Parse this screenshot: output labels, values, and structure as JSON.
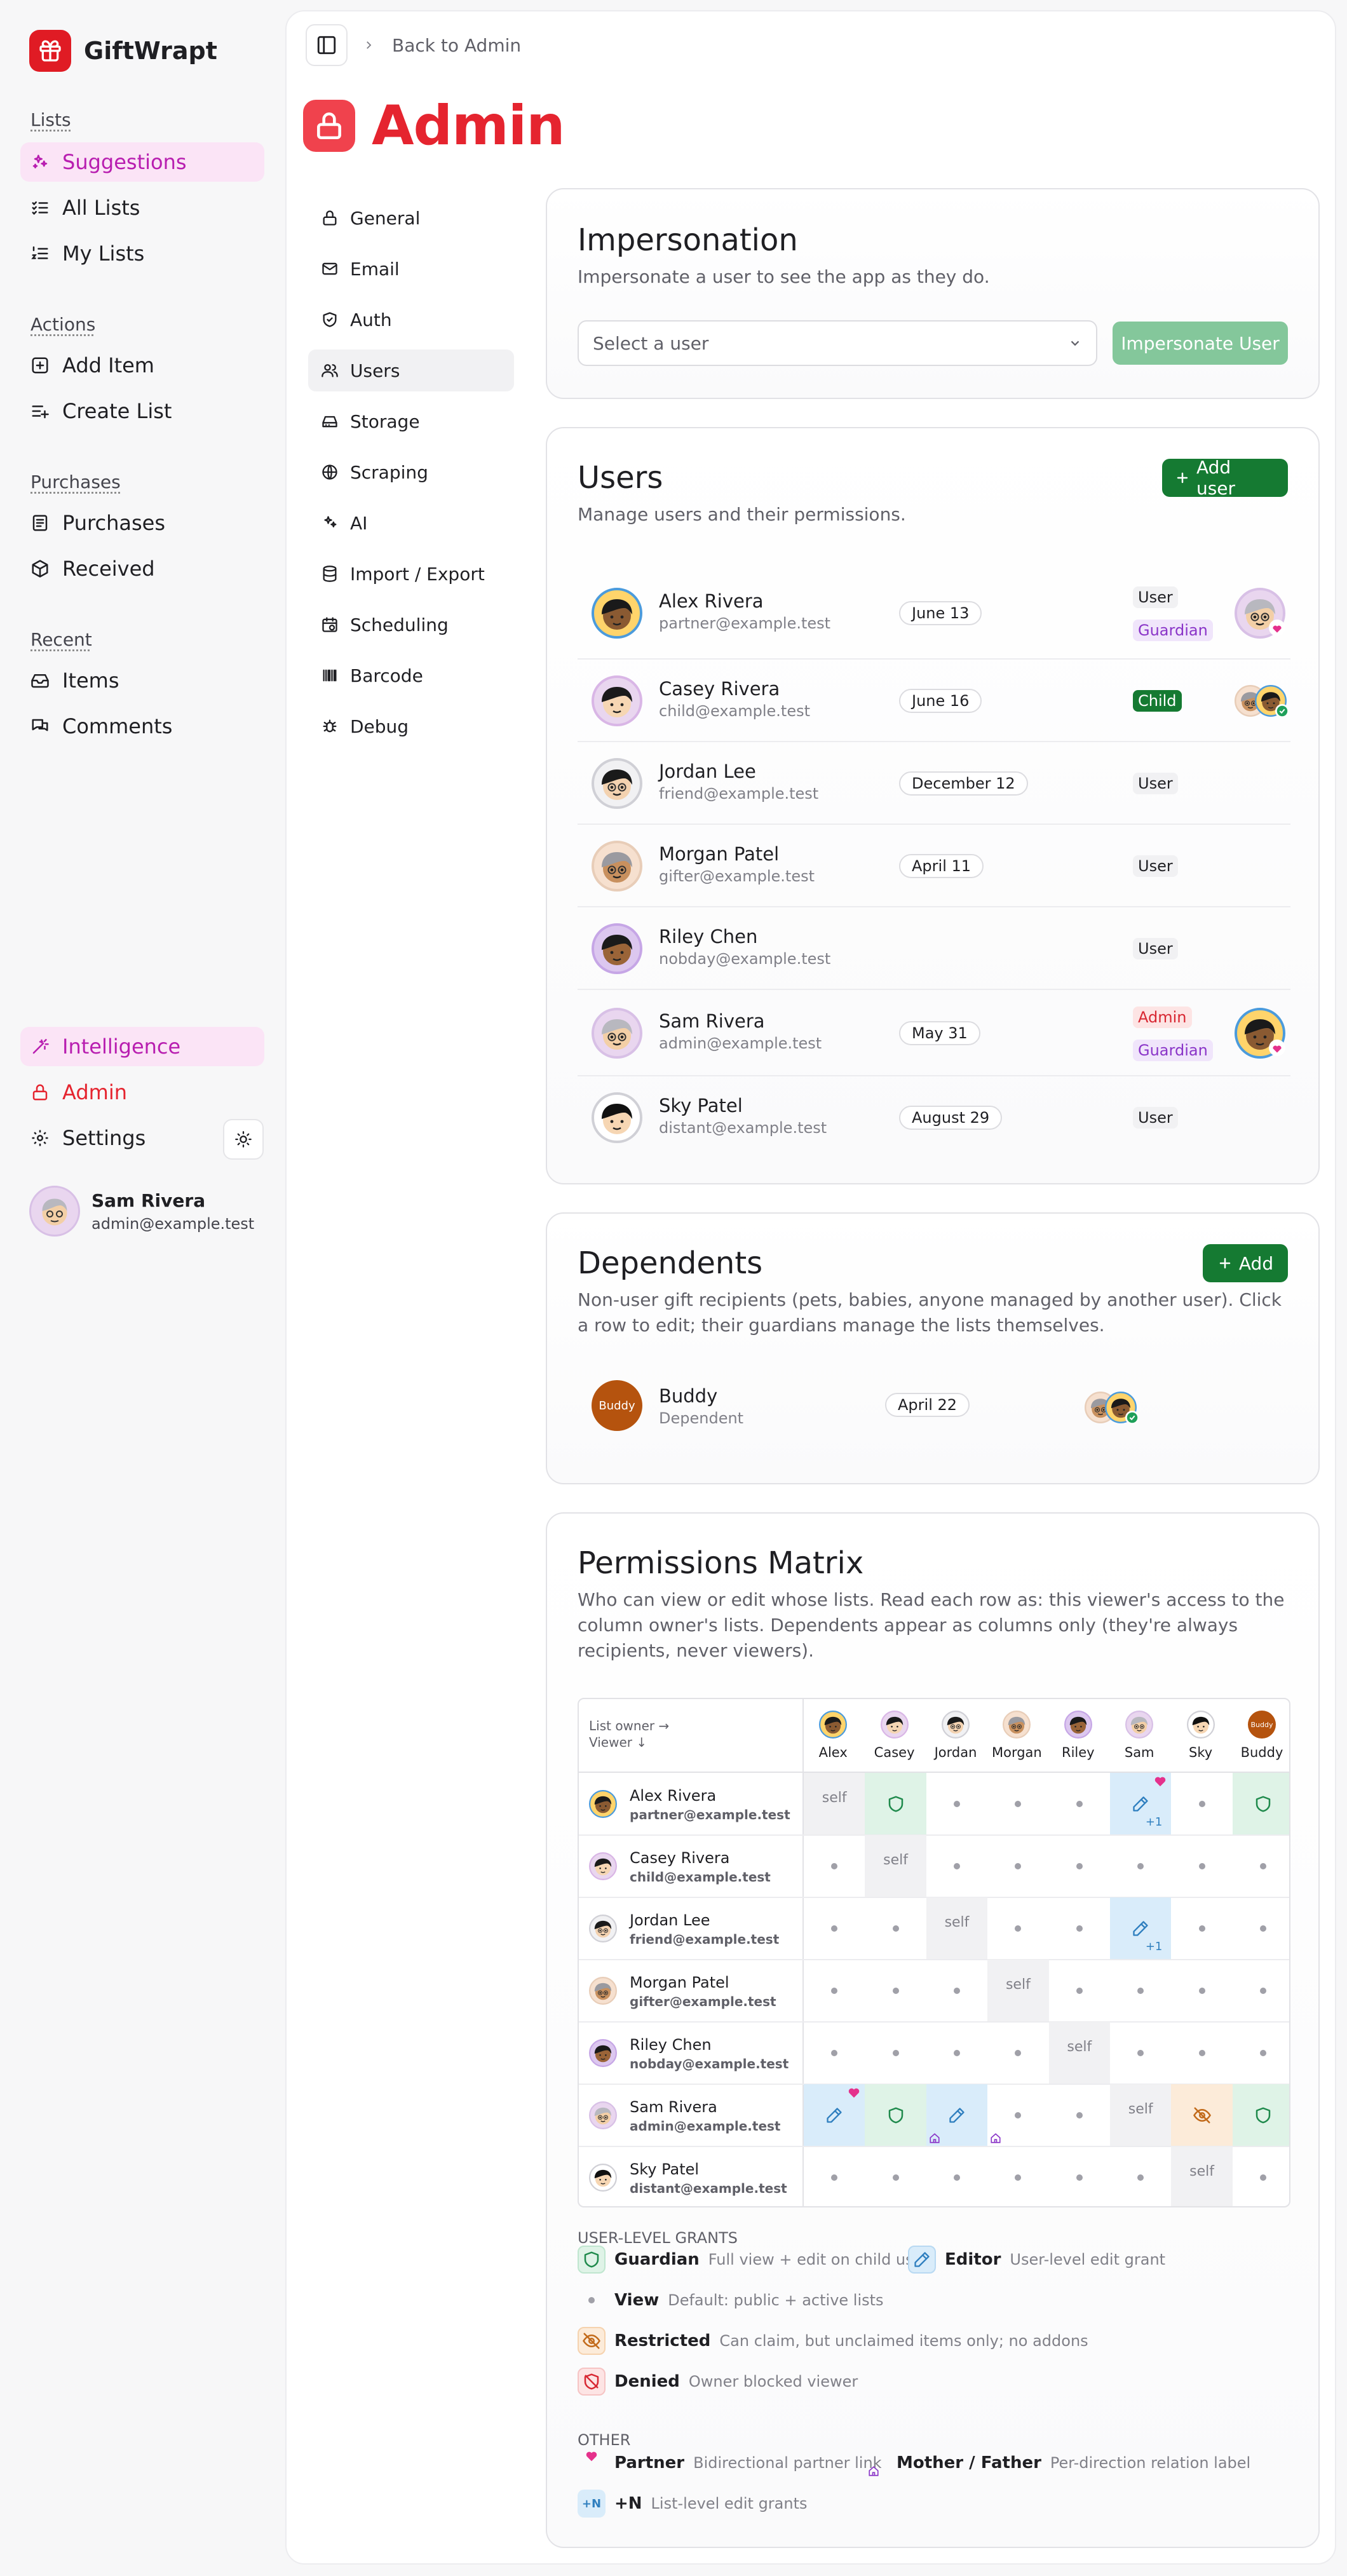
{
  "brand": {
    "name": "GiftWrapt"
  },
  "sidebar": {
    "sections": [
      {
        "head": "Lists",
        "items": [
          {
            "label": "Suggestions",
            "icon": "sparkles-icon"
          },
          {
            "label": "All Lists",
            "icon": "list-check-icon"
          },
          {
            "label": "My Lists",
            "icon": "list-ordered-icon"
          }
        ]
      },
      {
        "head": "Actions",
        "items": [
          {
            "label": "Add Item",
            "icon": "plus-square-icon"
          },
          {
            "label": "Create List",
            "icon": "list-plus-icon"
          }
        ]
      },
      {
        "head": "Purchases",
        "items": [
          {
            "label": "Purchases",
            "icon": "receipt-icon"
          },
          {
            "label": "Received",
            "icon": "package-icon"
          }
        ]
      },
      {
        "head": "Recent",
        "items": [
          {
            "label": "Items",
            "icon": "inbox-icon"
          },
          {
            "label": "Comments",
            "icon": "comments-icon"
          }
        ]
      }
    ],
    "bottom": [
      {
        "label": "Intelligence",
        "icon": "wand-icon"
      },
      {
        "label": "Admin",
        "icon": "lock-icon"
      },
      {
        "label": "Settings",
        "icon": "gear-icon"
      }
    ],
    "user": {
      "name": "Sam Rivera",
      "email": "admin@example.test"
    }
  },
  "header": {
    "crumb": "Back to Admin",
    "title": "Admin"
  },
  "subnav": [
    "General",
    "Email",
    "Auth",
    "Users",
    "Storage",
    "Scraping",
    "AI",
    "Import / Export",
    "Scheduling",
    "Barcode",
    "Debug"
  ],
  "impersonation": {
    "title": "Impersonation",
    "desc": "Impersonate a user to see the app as they do.",
    "placeholder": "Select a user",
    "button": "Impersonate User"
  },
  "users": {
    "title": "Users",
    "desc": "Manage users and their permissions.",
    "add": "Add user",
    "rows": [
      {
        "name": "Alex Rivera",
        "email": "partner@example.test",
        "date": "June 13",
        "tags": [
          "User",
          "Guardian"
        ]
      },
      {
        "name": "Casey Rivera",
        "email": "child@example.test",
        "date": "June 16",
        "tags": [
          "Child"
        ]
      },
      {
        "name": "Jordan Lee",
        "email": "friend@example.test",
        "date": "December 12",
        "tags": [
          "User"
        ]
      },
      {
        "name": "Morgan Patel",
        "email": "gifter@example.test",
        "date": "April 11",
        "tags": [
          "User"
        ]
      },
      {
        "name": "Riley Chen",
        "email": "nobday@example.test",
        "date": "",
        "tags": [
          "User"
        ]
      },
      {
        "name": "Sam Rivera",
        "email": "admin@example.test",
        "date": "May 31",
        "tags": [
          "Admin",
          "Guardian"
        ]
      },
      {
        "name": "Sky Patel",
        "email": "distant@example.test",
        "date": "August 29",
        "tags": [
          "User"
        ]
      }
    ]
  },
  "dependents": {
    "title": "Dependents",
    "desc": "Non-user gift recipients (pets, babies, anyone managed by another user). Click a row to edit; their guardians manage the lists themselves.",
    "add": "Add",
    "rows": [
      {
        "name": "Buddy",
        "sub": "Dependent",
        "date": "April 22",
        "avatar": "Buddy"
      }
    ]
  },
  "matrix": {
    "title": "Permissions Matrix",
    "desc": "Who can view or edit whose lists. Read each row as: this viewer's access to the column owner's lists. Dependents appear as columns only (they're always recipients, never viewers).",
    "corner1": "List owner →",
    "corner2": "Viewer ↓",
    "columns": [
      "Alex",
      "Casey",
      "Jordan",
      "Morgan",
      "Riley",
      "Sam",
      "Sky",
      "Buddy"
    ],
    "cells": [
      [
        "self",
        "guardian",
        "view",
        "view",
        "view",
        "editor+1",
        "view",
        "guardian"
      ],
      [
        "view",
        "self",
        "view",
        "view",
        "view",
        "view",
        "view",
        "view"
      ],
      [
        "view",
        "view",
        "self",
        "view",
        "view",
        "editor+1",
        "view",
        "view"
      ],
      [
        "view",
        "view",
        "view",
        "self",
        "view",
        "view",
        "view",
        "view"
      ],
      [
        "view",
        "view",
        "view",
        "view",
        "self",
        "view",
        "view",
        "view"
      ],
      [
        "editor",
        "guardian",
        "editor",
        "view",
        "view",
        "self",
        "restricted",
        "guardian"
      ],
      [
        "view",
        "view",
        "view",
        "view",
        "view",
        "view",
        "self",
        "view"
      ]
    ],
    "self_label": "self",
    "plus_label": "+1",
    "legend_user_head": "USER-LEVEL GRANTS",
    "legend_other_head": "OTHER",
    "legend": [
      {
        "name": "Guardian",
        "desc": "Full view + edit on child user"
      },
      {
        "name": "Editor",
        "desc": "User-level edit grant"
      },
      {
        "name": "View",
        "desc": "Default: public + active lists"
      },
      {
        "name": "Restricted",
        "desc": "Can claim, but unclaimed items only; no addons"
      },
      {
        "name": "Denied",
        "desc": "Owner blocked viewer"
      },
      {
        "name": "Partner",
        "desc": "Bidirectional partner link"
      },
      {
        "name": "Mother / Father",
        "desc": "Per-direction relation label"
      },
      {
        "name": "+N",
        "desc": "List-level edit grants",
        "badge": "+N"
      }
    ]
  },
  "colors": {
    "accent": "#e5242f",
    "green": "#157a32",
    "pink": "#b81eb0"
  }
}
